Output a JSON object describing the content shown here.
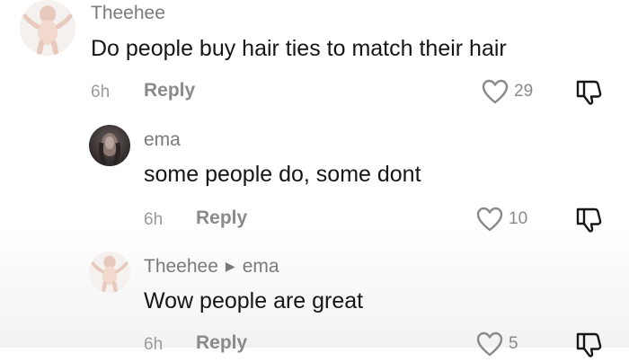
{
  "comments": [
    {
      "author": "Theehee",
      "text": "Do people buy hair ties to match their hair",
      "time": "6h",
      "reply_label": "Reply",
      "likes": "29",
      "avatar": "baby-avatar"
    },
    {
      "author": "ema",
      "text": "some people do, some dont",
      "time": "6h",
      "reply_label": "Reply",
      "likes": "10",
      "avatar": "girl-avatar"
    },
    {
      "author": "Theehee",
      "reply_to": "ema",
      "text": "Wow people are great",
      "time": "6h",
      "reply_label": "Reply",
      "likes": "5",
      "avatar": "baby-avatar"
    }
  ],
  "icons": {
    "like": "heart-outline-icon",
    "dislike": "thumbs-down-outline-icon",
    "reply_arrow": "caret-right-icon"
  },
  "colors": {
    "text": "#161616",
    "secondary": "#8a8a8a",
    "author": "#7a7a7a"
  }
}
